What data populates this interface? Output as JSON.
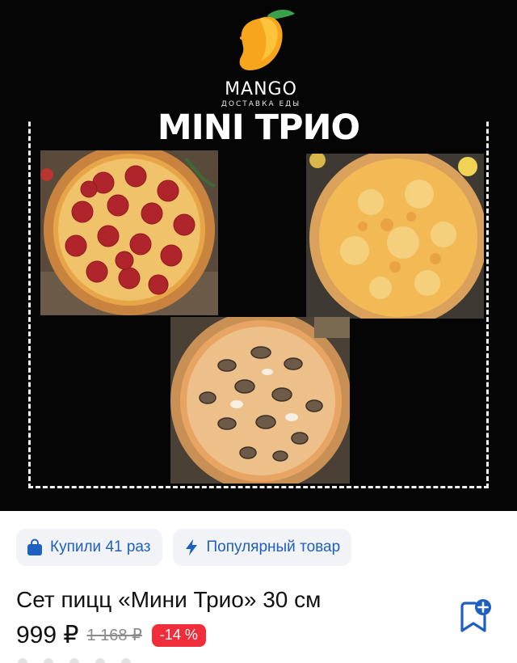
{
  "banner": {
    "brand": "MANGO",
    "brand_sub": "ДОСТАВКА ЕДЫ",
    "title": "MINI ТРИО"
  },
  "badges": [
    {
      "icon": "shopping-bag-icon",
      "label": "Купили 41 раз"
    },
    {
      "icon": "lightning-icon",
      "label": "Популярный товар"
    }
  ],
  "product": {
    "title": "Сет пицц «Мини Трио» 30 см",
    "price": "999 ₽",
    "old_price": "1 168 ₽",
    "discount": "-14 %"
  },
  "colors": {
    "accent": "#1f5fbf",
    "badge_bg": "#f1f3f6",
    "discount_bg": "#ef2d3b",
    "banner_bg": "#050505"
  }
}
